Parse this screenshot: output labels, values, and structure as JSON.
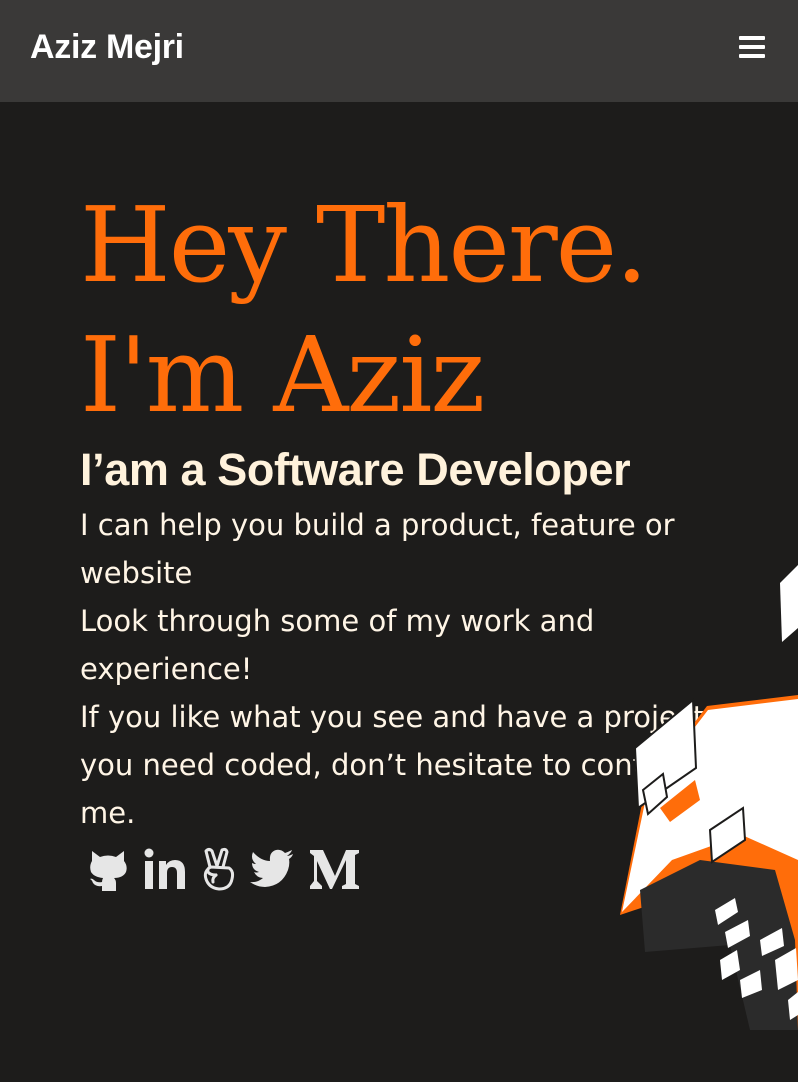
{
  "header": {
    "brand": "Aziz Mejri",
    "menu_icon": "hamburger-menu-icon"
  },
  "hero": {
    "title_line1": "Hey There.",
    "title_line2": "I'm Aziz",
    "subtitle": "I’am a Software Developer",
    "paragraphs": [
      "I can help you build a product, feature or website",
      "Look through some of my work and experience!",
      "If you like what you see and have a project you need coded, don’t hesitate to contact me."
    ]
  },
  "socials": [
    {
      "name": "GitHub",
      "icon": "github-icon"
    },
    {
      "name": "LinkedIn",
      "icon": "linkedin-icon"
    },
    {
      "name": "AngelList",
      "icon": "angellist-icon"
    },
    {
      "name": "Twitter",
      "icon": "twitter-icon"
    },
    {
      "name": "Medium",
      "icon": "medium-icon"
    }
  ],
  "colors": {
    "background": "#1d1c1b",
    "navbar": "#3a3938",
    "accent": "#ff6d0a",
    "heading": "#fff2dc",
    "text": "#fff5e6",
    "icons": "#e6e6e6"
  }
}
